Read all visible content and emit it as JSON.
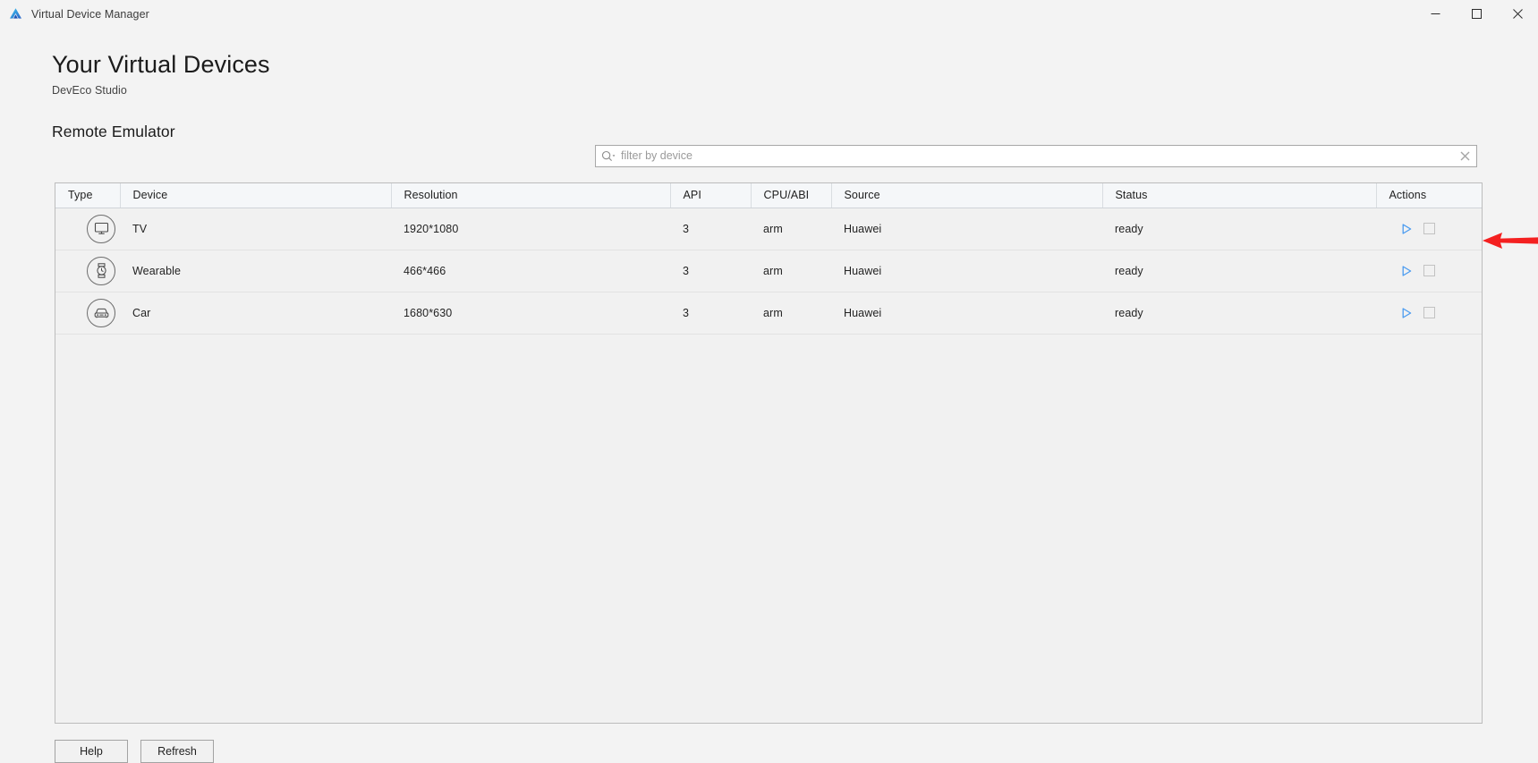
{
  "window": {
    "title": "Virtual Device Manager",
    "logo_icon": "deveco-triangle-logo",
    "controls": [
      {
        "name": "minimize",
        "icon": "minimize-icon"
      },
      {
        "name": "maximize",
        "icon": "maximize-icon"
      },
      {
        "name": "close",
        "icon": "close-icon"
      }
    ]
  },
  "header": {
    "title": "Your Virtual Devices",
    "subtitle": "DevEco Studio"
  },
  "section": {
    "title": "Remote Emulator"
  },
  "search": {
    "placeholder": "filter by device",
    "value": "",
    "icon": "search-icon",
    "clear_icon": "clear-icon"
  },
  "table": {
    "columns": [
      {
        "key": "type",
        "label": "Type"
      },
      {
        "key": "device",
        "label": "Device"
      },
      {
        "key": "resolution",
        "label": "Resolution"
      },
      {
        "key": "api",
        "label": "API"
      },
      {
        "key": "cpu_abi",
        "label": "CPU/ABI"
      },
      {
        "key": "source",
        "label": "Source"
      },
      {
        "key": "status",
        "label": "Status"
      },
      {
        "key": "actions",
        "label": "Actions"
      }
    ],
    "rows": [
      {
        "type_icon": "tv-icon",
        "device": "TV",
        "resolution": "1920*1080",
        "api": "3",
        "cpu_abi": "arm",
        "source": "Huawei",
        "status": "ready",
        "actions": {
          "play_icon": "play-icon",
          "stop_icon": "stop-icon"
        }
      },
      {
        "type_icon": "watch-icon",
        "device": "Wearable",
        "resolution": "466*466",
        "api": "3",
        "cpu_abi": "arm",
        "source": "Huawei",
        "status": "ready",
        "actions": {
          "play_icon": "play-icon",
          "stop_icon": "stop-icon"
        }
      },
      {
        "type_icon": "car-icon",
        "device": "Car",
        "resolution": "1680*630",
        "api": "3",
        "cpu_abi": "arm",
        "source": "Huawei",
        "status": "ready",
        "actions": {
          "play_icon": "play-icon",
          "stop_icon": "stop-icon"
        }
      }
    ]
  },
  "footer": {
    "help_label": "Help",
    "refresh_label": "Refresh"
  },
  "annotation": {
    "arrow_icon": "red-left-arrow-annotation",
    "color": "#f42020",
    "points_at_row": "Wearable"
  },
  "colors": {
    "accent_play": "#4a9bf0",
    "window_bg": "#f3f3f3",
    "table_bg": "#f1f1f1",
    "header_bg": "#f5f7f9",
    "annotation_red": "#f42020"
  }
}
